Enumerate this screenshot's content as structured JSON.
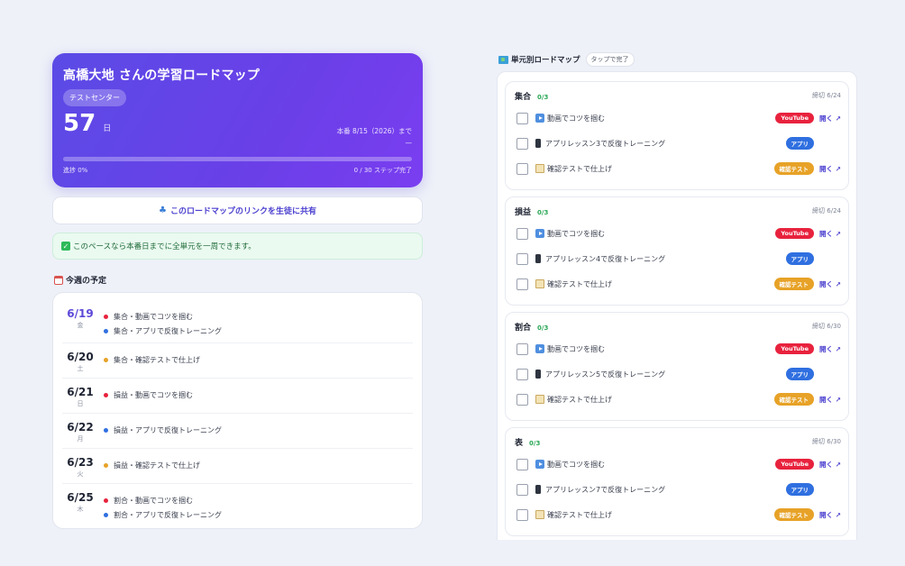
{
  "hero": {
    "title": "高橋大地 さんの学習ロードマップ",
    "badge": "テストセンター",
    "days_left": "57",
    "days_unit": "日",
    "exam_line1": "本番 8/15（2026）まで",
    "exam_line2": "—",
    "progress_fraction": 0,
    "progress_label": "進捗 0%",
    "steps_label": "0 / 30 ステップ完了"
  },
  "share_button": "このロードマップのリンクを生徒に共有",
  "pace_note": "このペースなら本番日までに全単元を一周できます。",
  "week": {
    "title": "今週の予定",
    "days": [
      {
        "date": "6/19",
        "weekday": "金",
        "today": true,
        "items": [
          {
            "text": "集合・動画でコツを掴む",
            "color": "#e8223d"
          },
          {
            "text": "集合・アプリで反復トレーニング",
            "color": "#2f6fe0"
          }
        ]
      },
      {
        "date": "6/20",
        "weekday": "土",
        "items": [
          {
            "text": "集合・確認テストで仕上げ",
            "color": "#e7a227"
          }
        ]
      },
      {
        "date": "6/21",
        "weekday": "日",
        "items": [
          {
            "text": "損益・動画でコツを掴む",
            "color": "#e8223d"
          }
        ]
      },
      {
        "date": "6/22",
        "weekday": "月",
        "items": [
          {
            "text": "損益・アプリで反復トレーニング",
            "color": "#2f6fe0"
          }
        ]
      },
      {
        "date": "6/23",
        "weekday": "火",
        "items": [
          {
            "text": "損益・確認テストで仕上げ",
            "color": "#e7a227"
          }
        ]
      },
      {
        "date": "6/25",
        "weekday": "木",
        "items": [
          {
            "text": "割合・動画でコツを掴む",
            "color": "#e8223d"
          },
          {
            "text": "割合・アプリで反復トレーニング",
            "color": "#2f6fe0"
          }
        ]
      }
    ]
  },
  "roadmap": {
    "title": "単元別ロードマップ",
    "tag": "タップで完了",
    "units": [
      {
        "name": "集合",
        "count": "0/3",
        "deadline": "締切 6/24",
        "tasks": [
          {
            "icon": "play-icon",
            "label": "動画でコツを掴む",
            "pill": "YouTube",
            "kind": "yt",
            "open": "開く ↗"
          },
          {
            "icon": "phone-icon",
            "label": "アプリレッスン3で反復トレーニング",
            "pill": "アプリ",
            "kind": "app",
            "open": ""
          },
          {
            "icon": "memo-icon",
            "label": "確認テストで仕上げ",
            "pill": "確認テスト",
            "kind": "test",
            "open": "開く ↗"
          }
        ]
      },
      {
        "name": "損益",
        "count": "0/3",
        "deadline": "締切 6/24",
        "tasks": [
          {
            "icon": "play-icon",
            "label": "動画でコツを掴む",
            "pill": "YouTube",
            "kind": "yt",
            "open": "開く ↗"
          },
          {
            "icon": "phone-icon",
            "label": "アプリレッスン4で反復トレーニング",
            "pill": "アプリ",
            "kind": "app",
            "open": ""
          },
          {
            "icon": "memo-icon",
            "label": "確認テストで仕上げ",
            "pill": "確認テスト",
            "kind": "test",
            "open": "開く ↗"
          }
        ]
      },
      {
        "name": "割合",
        "count": "0/3",
        "deadline": "締切 6/30",
        "tasks": [
          {
            "icon": "play-icon",
            "label": "動画でコツを掴む",
            "pill": "YouTube",
            "kind": "yt",
            "open": "開く ↗"
          },
          {
            "icon": "phone-icon",
            "label": "アプリレッスン5で反復トレーニング",
            "pill": "アプリ",
            "kind": "app",
            "open": ""
          },
          {
            "icon": "memo-icon",
            "label": "確認テストで仕上げ",
            "pill": "確認テスト",
            "kind": "test",
            "open": "開く ↗"
          }
        ]
      },
      {
        "name": "表",
        "count": "0/3",
        "deadline": "締切 6/30",
        "tasks": [
          {
            "icon": "play-icon",
            "label": "動画でコツを掴む",
            "pill": "YouTube",
            "kind": "yt",
            "open": "開く ↗"
          },
          {
            "icon": "phone-icon",
            "label": "アプリレッスン7で反復トレーニング",
            "pill": "アプリ",
            "kind": "app",
            "open": ""
          },
          {
            "icon": "memo-icon",
            "label": "確認テストで仕上げ",
            "pill": "確認テスト",
            "kind": "test",
            "open": "開く ↗"
          }
        ]
      }
    ]
  },
  "colors": {
    "accent": "#5b48d8",
    "youtube": "#e8223d",
    "app": "#2f6fe0",
    "test": "#e7a227",
    "success": "#2aa755"
  }
}
